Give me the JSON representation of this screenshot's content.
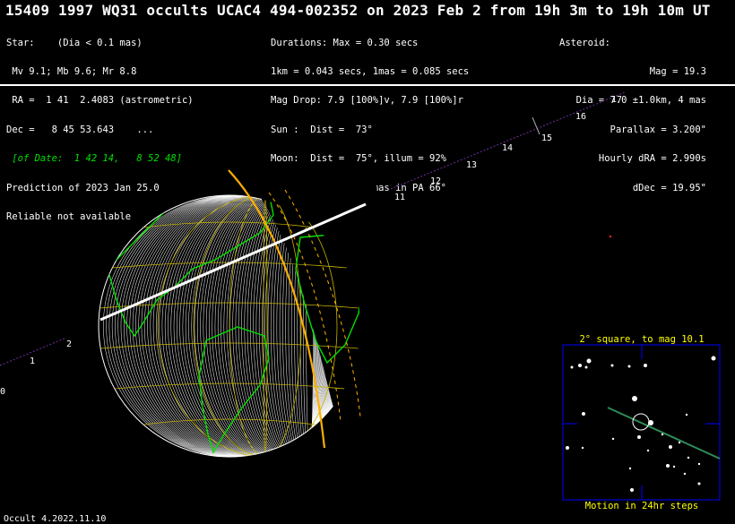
{
  "title": "15409 1997 WQ31 occults UCAC4 494-002352 on 2023 Feb  2 from 19h  3m to 19h 10m UT",
  "star": {
    "lines": [
      "Star:    (Dia < 0.1 mas)",
      " Mv 9.1; Mb 9.6; Mr 8.8",
      " RA =  1 41  2.4083 (astrometric)",
      "Dec =   8 45 53.643    ..."
    ],
    "of_date": " [of Date:  1 42 14,   8 52 48]",
    "prediction": "Prediction of 2023 Jan 25.0",
    "reliable": "Reliable not available"
  },
  "event": {
    "lines": [
      "Durations: Max = 0.30 secs",
      "1km = 0.043 secs, 1mas = 0.085 secs",
      "Mag Drop: 7.9 [100%]v, 7.9 [100%]r",
      "Sun :  Dist =  73°",
      "Moon:  Dist =  75°, illum = 92%",
      "Error 14.0 x 11.0 mas in PA 66°"
    ]
  },
  "asteroid": {
    "lines": [
      "Asteroid:",
      "Mag = 19.3",
      "Dia = 7.0 ±1.0km, 4 mas",
      "Parallax = 3.200\"",
      "Hourly dRA = 2.990s",
      "dDec = 19.95\""
    ]
  },
  "path_hours": [
    "0",
    "1",
    "2",
    "11",
    "12",
    "13",
    "14",
    "15",
    "16",
    "17"
  ],
  "inset": {
    "title": "2° square, to mag 10.1",
    "footer": "Motion in 24hr steps"
  },
  "footer": "Occult 4.2022.11.10",
  "colors": {
    "land": "#00e000",
    "grid": "#c8b400",
    "shadow_edge": "#ffb000",
    "path_track": "#7030a0",
    "inset_frame": "#0000ff",
    "inset_motion": "#2e8b57",
    "centre_line": "#ffffff"
  }
}
